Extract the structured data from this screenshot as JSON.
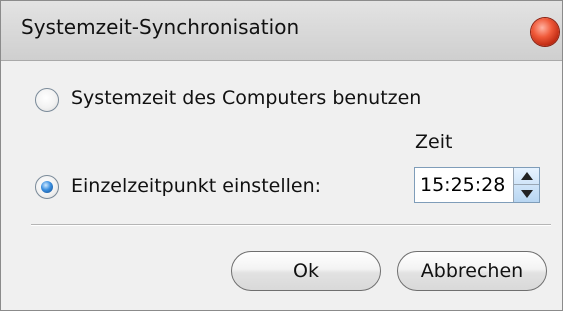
{
  "window": {
    "title": "Systemzeit-Synchronisation",
    "close_color": "#e2472a"
  },
  "options": {
    "use_computer_time": {
      "label": "Systemzeit des Computers benutzen",
      "checked": false
    },
    "single_time": {
      "label": "Einzelzeitpunkt einstellen:",
      "checked": true
    }
  },
  "time": {
    "header": "Zeit",
    "value": "15:25:28"
  },
  "buttons": {
    "ok": "Ok",
    "cancel": "Abbrechen"
  }
}
